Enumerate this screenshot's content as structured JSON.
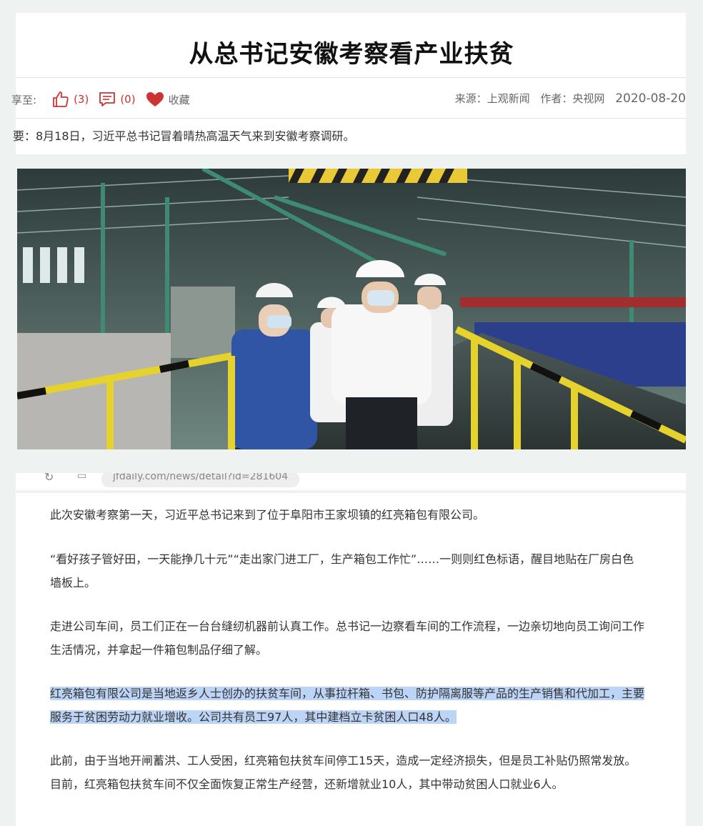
{
  "article": {
    "title": "从总书记安徽考察看产业扶贫",
    "share_label": "享至:",
    "like_count": "(3)",
    "comment_count": "(0)",
    "favorite_label": "收藏",
    "source": "来源：上观新闻",
    "author": "作者：央视网",
    "date": "2020-08-20",
    "summary": "要：8月18日，习近平总书记冒着晴热高温天气来到安徽考察调研。",
    "browser_url": "jfdaily.com/news/detail?id=281604",
    "paragraphs": [
      "此次安徽考察第一天，习近平总书记来到了位于阜阳市王家坝镇的红亮箱包有限公司。",
      "“看好孩子管好田，一天能挣几十元”“走出家门进工厂，生产箱包工作忙”……一则则红色标语，醒目地贴在厂房白色墙板上。",
      "走进公司车间，员工们正在一台台缝纫机器前认真工作。总书记一边察看车间的工作流程，一边亲切地向员工询问工作生活情况，并拿起一件箱包制品仔细了解。",
      "红亮箱包有限公司是当地返乡人士创办的扶贫车间，从事拉杆箱、书包、防护隔离服等产品的生产销售和代加工，主要服务于贫困劳动力就业增收。公司共有员工97人，其中建档立卡贫困人口48人。",
      "此前，由于当地开闸蓄洪、工人受困，红亮箱包扶贫车间停工15天，造成一定经济损失，但是员工补贴仍照常发放。目前，红亮箱包扶贫车间不仅全面恢复正常生产经营，还新增就业10人，其中带动贫困人口就业6人。"
    ]
  },
  "colors": {
    "accent_red": "#cc3333",
    "highlight": "#bcd4f5",
    "background": "#eef2f0"
  }
}
